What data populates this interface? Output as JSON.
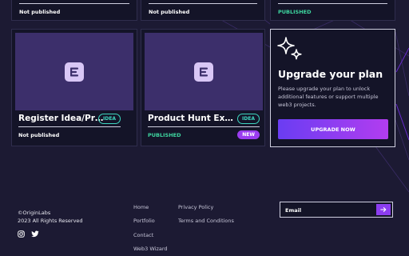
{
  "top_cards": [
    {
      "status": "Not published",
      "status_type": "unpublished"
    },
    {
      "status": "Not published",
      "status_type": "unpublished"
    },
    {
      "status": "PUBLISHED",
      "status_type": "published"
    }
  ],
  "projects": [
    {
      "title": "Register Idea/Project...",
      "badge": "IDEA",
      "status": "Not published",
      "status_type": "unpublished",
      "new_badge": ""
    },
    {
      "title": "Product Hunt Example",
      "badge": "IDEA",
      "status": "PUBLISHED",
      "status_type": "published",
      "new_badge": "NEW"
    }
  ],
  "upgrade": {
    "title": "Upgrade your plan",
    "description": "Please upgrade your plan to unlock additional features or support multiple web3 projects.",
    "button_label": "UPGRADE NOW"
  },
  "footer": {
    "copyright_line1": "©OriginLabs",
    "copyright_line2": "2023 All Rights Reserved",
    "links_col1": [
      "Home",
      "Portfolio",
      "Contact",
      "Web3 Wizard"
    ],
    "links_col2": [
      "Privacy Policy",
      "Terms and Conditions"
    ],
    "email_placeholder": "Email"
  },
  "colors": {
    "background": "#1c1a33",
    "published": "#3ed7a0",
    "accent": "#9b3df0"
  },
  "icons": [
    "sparkle-icon",
    "project-logo-icon",
    "instagram-icon",
    "twitter-icon",
    "arrow-right-icon"
  ]
}
